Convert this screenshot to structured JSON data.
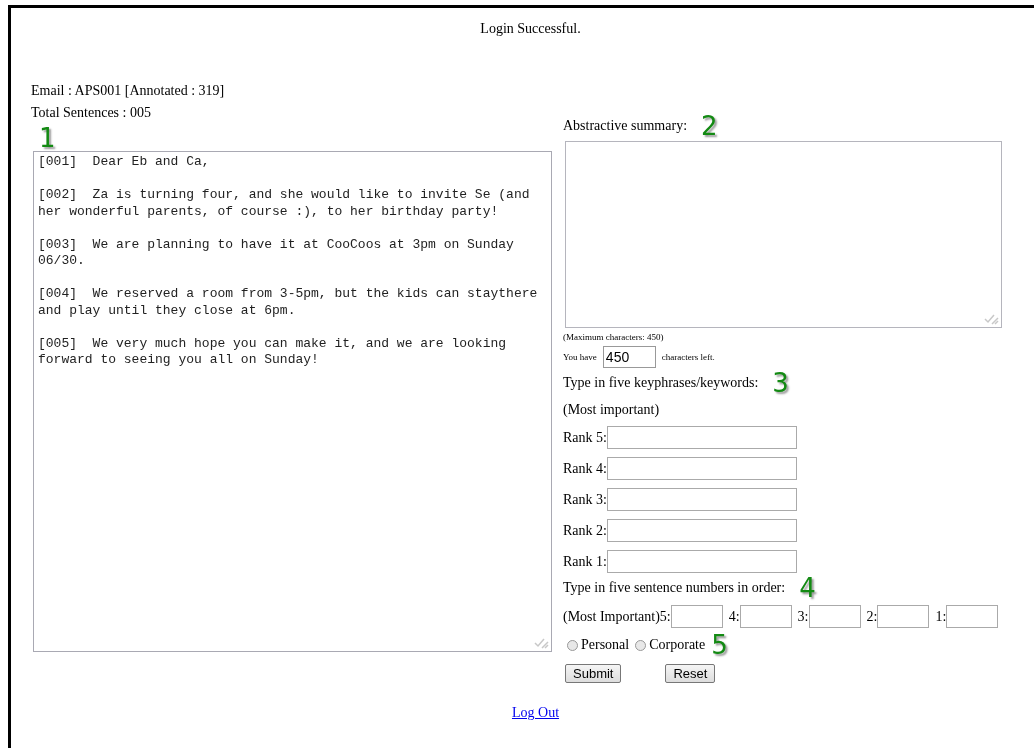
{
  "status": "Login Successful.",
  "email_line": "Email : APS001 [Annotated : 319]",
  "total_line": "Total Sentences : 005",
  "markers": [
    "1",
    "2",
    "3",
    "4",
    "5"
  ],
  "sentences": [
    {
      "id": "[001]",
      "text": "Dear Eb and Ca,"
    },
    {
      "id": "[002]",
      "text": "Za is turning four, and she would like to invite Se (and her wonderful parents, of course :), to her birthday party!"
    },
    {
      "id": "[003]",
      "text": "We are planning to have it at CooCoos at 3pm on Sunday 06/30."
    },
    {
      "id": "[004]",
      "text": "We reserved a room from 3-5pm, but the kids can staythere and play until they close at 6pm."
    },
    {
      "id": "[005]",
      "text": "We very much hope you can make it, and we are looking forward to seeing you all on Sunday!"
    }
  ],
  "summary": {
    "label": "Abstractive summary:",
    "max_note": "(Maximum characters: 450)",
    "left_prefix": "You have",
    "left_value": "450",
    "left_suffix": "characters left."
  },
  "keyphrases": {
    "label": "Type in five keyphrases/keywords:",
    "note": "(Most important)",
    "ranks": [
      "Rank 5:",
      "Rank 4:",
      "Rank 3:",
      "Rank 2:",
      "Rank 1:"
    ]
  },
  "order": {
    "label": "Type in five sentence numbers in order:",
    "slots": [
      "(Most Important)5:",
      "4:",
      "3:",
      "2:",
      "1:"
    ]
  },
  "category": [
    {
      "label": "Personal",
      "selected": false
    },
    {
      "label": "Corporate",
      "selected": false
    }
  ],
  "buttons": [
    "Submit",
    "Reset"
  ],
  "logout": "Log Out"
}
